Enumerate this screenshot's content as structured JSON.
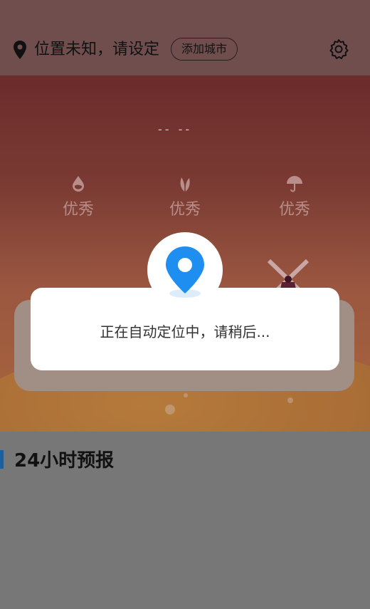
{
  "header": {
    "location_text": "位置未知，请设定",
    "add_city_label": "添加城市",
    "icons": [
      "location-pin-icon",
      "gear-icon"
    ]
  },
  "weather": {
    "temperature": "-- --",
    "metrics": [
      {
        "icon": "water-drop-icon",
        "value": "优秀"
      },
      {
        "icon": "leaf-icon",
        "value": "优秀"
      },
      {
        "icon": "umbrella-icon",
        "value": "优秀"
      }
    ]
  },
  "forecast": {
    "title": "24小时预报"
  },
  "dialog": {
    "message": "正在自动定位中，请稍后...",
    "icon": "map-marker-icon",
    "accent_color": "#1f8ef1"
  }
}
